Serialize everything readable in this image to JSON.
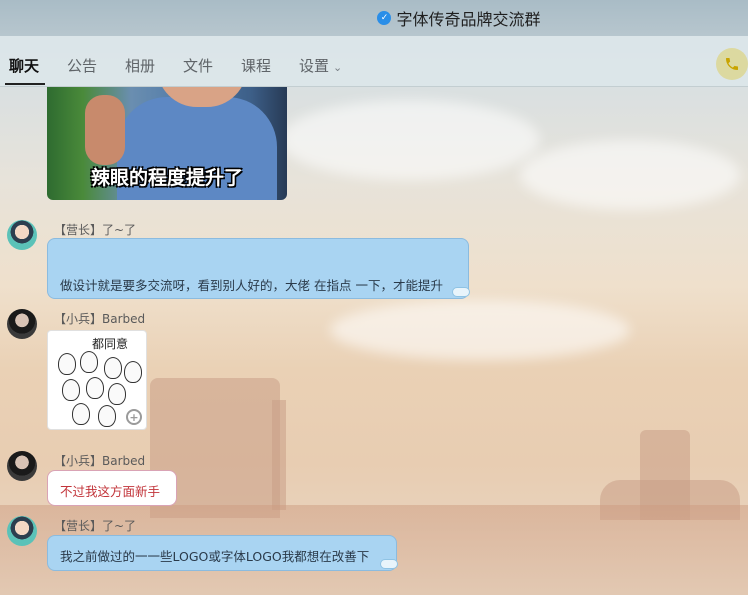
{
  "window": {
    "title": "字体传奇品牌交流群",
    "verified_icon": "verified-badge-icon"
  },
  "tabs": [
    {
      "label": "聊天",
      "active": true
    },
    {
      "label": "公告",
      "active": false
    },
    {
      "label": "相册",
      "active": false
    },
    {
      "label": "文件",
      "active": false
    },
    {
      "label": "课程",
      "active": false
    },
    {
      "label": "设置",
      "active": false,
      "has_dropdown": true
    }
  ],
  "call_button": {
    "icon": "phone-icon",
    "color": "#c9a400"
  },
  "messages": [
    {
      "type": "image",
      "caption": "辣眼的程度提升了"
    },
    {
      "sender": "【营长】了~了",
      "text": "做设计就是要多交流呀，看到别人好的，大佬 在指点 一下，才能提升",
      "bubble_color": "#a9d4f2"
    },
    {
      "sender": "【小兵】Barbed",
      "type": "sticker",
      "sticker_text": "都同意"
    },
    {
      "sender": "【小兵】Barbed",
      "text": "不过我这方面新手",
      "bubble_color": "#ffffff",
      "text_color": "#c2343a"
    },
    {
      "sender": "【营长】了~了",
      "text": "我之前做过的一一些LOGO或字体LOGO我都想在改善下",
      "bubble_color": "#a9d4f2"
    }
  ]
}
